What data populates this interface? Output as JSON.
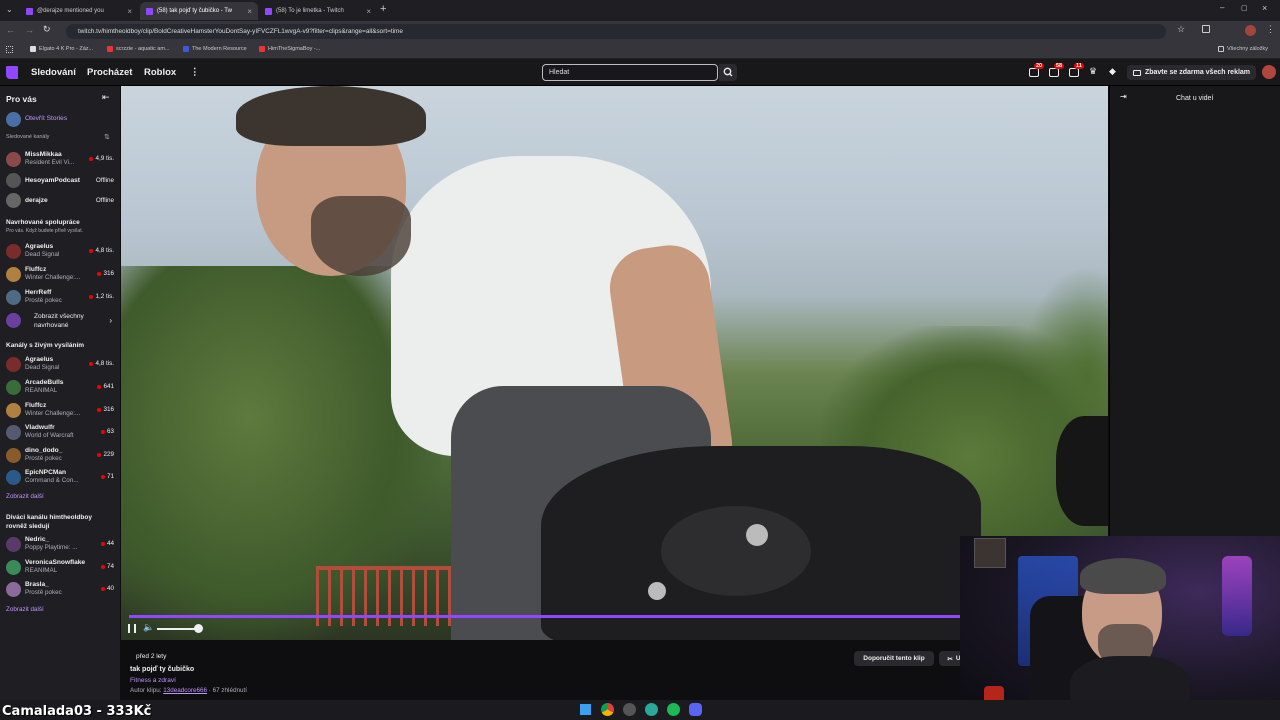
{
  "browser": {
    "tabs": [
      {
        "label": "@derajze mentioned you"
      },
      {
        "label": "(58) tak pojď ty čubičko - Tw"
      },
      {
        "label": "(58) To je limetka - Twitch"
      }
    ],
    "url": "twitch.tv/himtheoldboy/clip/BoldCreativeHamsterYouDontSay-yIFVCZFL1wvgA-v9?filter=clips&range=all&sort=time",
    "bookmarks": [
      {
        "label": "Elgato 4 K Pro - Záz..."
      },
      {
        "label": "scrzzie - aquatic am..."
      },
      {
        "label": "The Modern Resource"
      },
      {
        "label": "HimTheSigmaBoy -..."
      }
    ],
    "all_bookmarks": "Všechny záložky"
  },
  "nav": {
    "following": "Sledování",
    "browse": "Procházet",
    "roblox": "Roblox",
    "more": "⋮",
    "search_placeholder": "Hledat",
    "badges": [
      "20",
      "58",
      "11"
    ],
    "turbo": "Zbavte se zdarma všech reklam"
  },
  "sidebar": {
    "title": "Pro vás",
    "stories": "Otevřít Stories",
    "followed_header": "Sledované kanály",
    "followed": [
      {
        "name": "MissMikkaa",
        "game": "Resident Evil Vi...",
        "viewers": "4,9 tis."
      },
      {
        "name": "HesoyamPodcast",
        "status": "Offline"
      },
      {
        "name": "derajze",
        "status": "Offline"
      }
    ],
    "collab_header": "Navrhované spolupráce",
    "collab_sub": "Pro vás. Když budete přívě vysílat.",
    "collab": [
      {
        "name": "Agraelus",
        "game": "Dead Signal",
        "viewers": "4,8 tis."
      },
      {
        "name": "Fluffcz",
        "game": "Winter Challenge:...",
        "viewers": "316"
      },
      {
        "name": "HerrReff",
        "game": "Prostě pokec",
        "viewers": "1,2 tis."
      }
    ],
    "show_all": "Zobrazit všechny navrhované",
    "live_header": "Kanály s živým vysíláním",
    "live": [
      {
        "name": "Agraelus",
        "game": "Dead Signal",
        "viewers": "4,8 tis."
      },
      {
        "name": "ArcadeBulls",
        "game": "REANIMAL",
        "viewers": "641"
      },
      {
        "name": "Fluffcz",
        "game": "Winter Challenge:...",
        "viewers": "316"
      },
      {
        "name": "Vladwulfr",
        "game": "World of Warcraft",
        "viewers": "63"
      },
      {
        "name": "dino_dodo_",
        "game": "Prostě pokec",
        "viewers": "229"
      },
      {
        "name": "EpicNPCMan",
        "game": "Command & Con...",
        "viewers": "71"
      }
    ],
    "show_more_1": "Zobrazit další",
    "viewers_header": "Diváci kanálu himtheoldboy rovněž sledují",
    "viewers": [
      {
        "name": "Nedric_",
        "game": "Poppy Playtime: ...",
        "viewers": "44"
      },
      {
        "name": "VeronicaSnowflake",
        "game": "REANIMAL",
        "viewers": "74"
      },
      {
        "name": "Brasla_",
        "game": "Prostě pokec",
        "viewers": "40"
      }
    ],
    "show_more_2": "Zobrazit další"
  },
  "clip": {
    "age": "před 2 lety",
    "title": "tak pojď ty čubičko",
    "category": "Fitness a zdraví",
    "author_prefix": "Autor klipu:",
    "author": "13deadcore666",
    "views": "67 zhlédnutí",
    "recommend": "Doporučit tento klip",
    "edit": "U"
  },
  "player": {
    "progress": 1.0,
    "volume": 0.9
  },
  "chat": {
    "title": "Chat u videí"
  },
  "overlay": {
    "text": "Camalada03 - 333Kč"
  },
  "colors": {
    "accent": "#9147ff",
    "live": "#eb0400",
    "link": "#bf94ff"
  }
}
